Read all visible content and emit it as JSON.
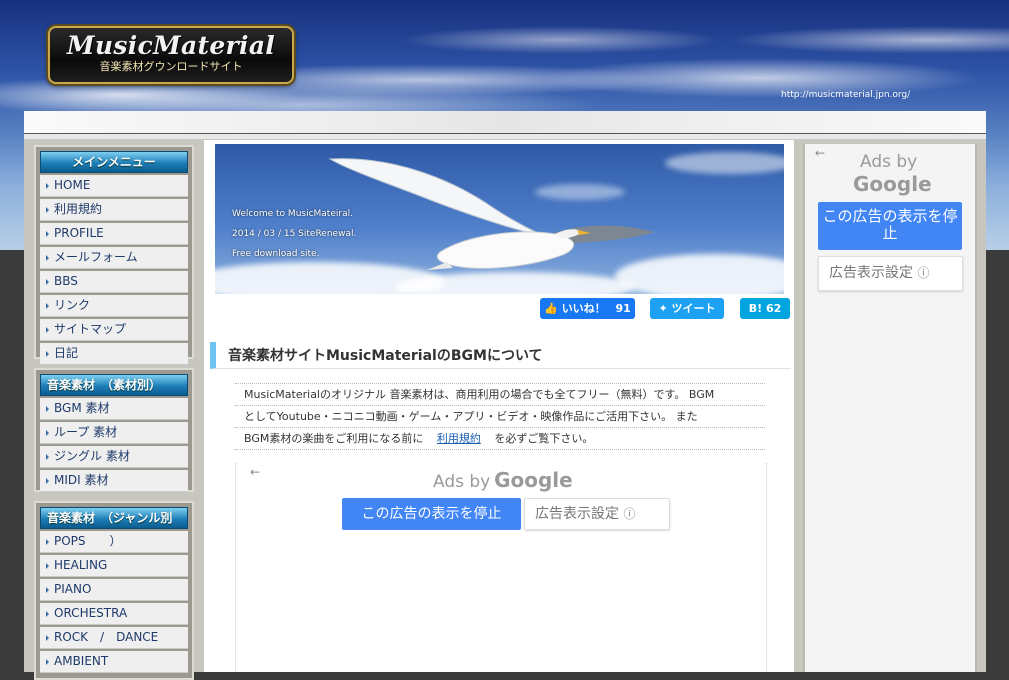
{
  "header": {
    "logo_title": "MusicMaterial",
    "logo_subtitle": "音楽素材グウンロードサイト",
    "site_url": "http://musicmaterial.jpn.org/"
  },
  "sidebar": {
    "main_menu": {
      "title": "メインメニュー",
      "items": [
        "HOME",
        "利用規約",
        "PROFILE",
        "メールフォーム",
        "BBS",
        "リンク",
        "サイトマップ",
        "日記"
      ]
    },
    "by_material": {
      "title": "音楽素材　（素材別）",
      "items": [
        "BGM 素材",
        "ループ 素材",
        "ジングル 素材",
        "MIDI 素材"
      ]
    },
    "by_genre": {
      "title": "音楽素材　（ジャンル別",
      "items": [
        "POPS　　）",
        "HEALING",
        "PIANO",
        "ORCHESTRA",
        "ROCK　/　DANCE",
        "AMBIENT"
      ]
    }
  },
  "hero": {
    "line1": "Welcome to MusicMateiral.",
    "line2": "2014 / 03 / 15 SiteRenewal.",
    "line3": "Free download site."
  },
  "social": {
    "like_label": "いいね！",
    "like_count": "91",
    "tweet_label": "ツイート",
    "hatena_label": "B!",
    "hatena_count": "62"
  },
  "main": {
    "section_title": "音楽素材サイトMusicMaterialのBGMについて",
    "intro_line1": "MusicMaterialのオリジナル 音楽素材は、商用利用の場合でも全てフリー（無料）です。 BGM",
    "intro_line2": "としてYoutube・ニコニコ動画・ゲーム・アプリ・ビデオ・映像作品にご活用下さい。 また",
    "intro_line3_pre": "BGM素材の楽曲をご利用になる前に",
    "intro_link": "利用規約",
    "intro_line3_post": "を必ずご覧下さい。"
  },
  "ads": {
    "ads_by": "Ads by",
    "google": "Google",
    "stop_button": "この広告の表示を停止",
    "settings_button": "広告表示設定",
    "info_icon": "ⓘ",
    "back_arrow": "←"
  },
  "colors": {
    "menu_head": "#1e7fb8",
    "link": "#1a5fb4",
    "facebook": "#1877f2",
    "twitter": "#1da1f2",
    "hatena": "#00a4de",
    "google_blue": "#4285f4"
  }
}
